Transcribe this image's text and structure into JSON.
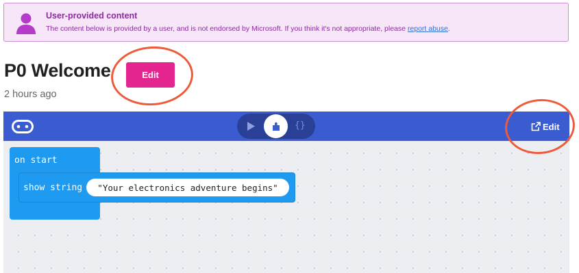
{
  "notice": {
    "title": "User-provided content",
    "body": "The content below is provided by a user, and is not endorsed by Microsoft. If you think it's not appropriate, please ",
    "link": "report abuse",
    "end": "."
  },
  "project": {
    "title": "P0 Welcome",
    "edit_label": "Edit",
    "timestamp": "2 hours ago"
  },
  "editor": {
    "toolbar": {
      "js_label": "{}",
      "edit_label": "Edit"
    },
    "blocks": {
      "event_label": "on start",
      "statement_label": "show string",
      "string_value": "\"Your electronics adventure begins\""
    }
  },
  "colors": {
    "brand_pink": "#e5258f",
    "toolbar_blue": "#3b5bd0",
    "block_blue": "#1e9bf0",
    "annotation_red": "#ee5a3a",
    "notice_purple": "#8c2aa0"
  }
}
